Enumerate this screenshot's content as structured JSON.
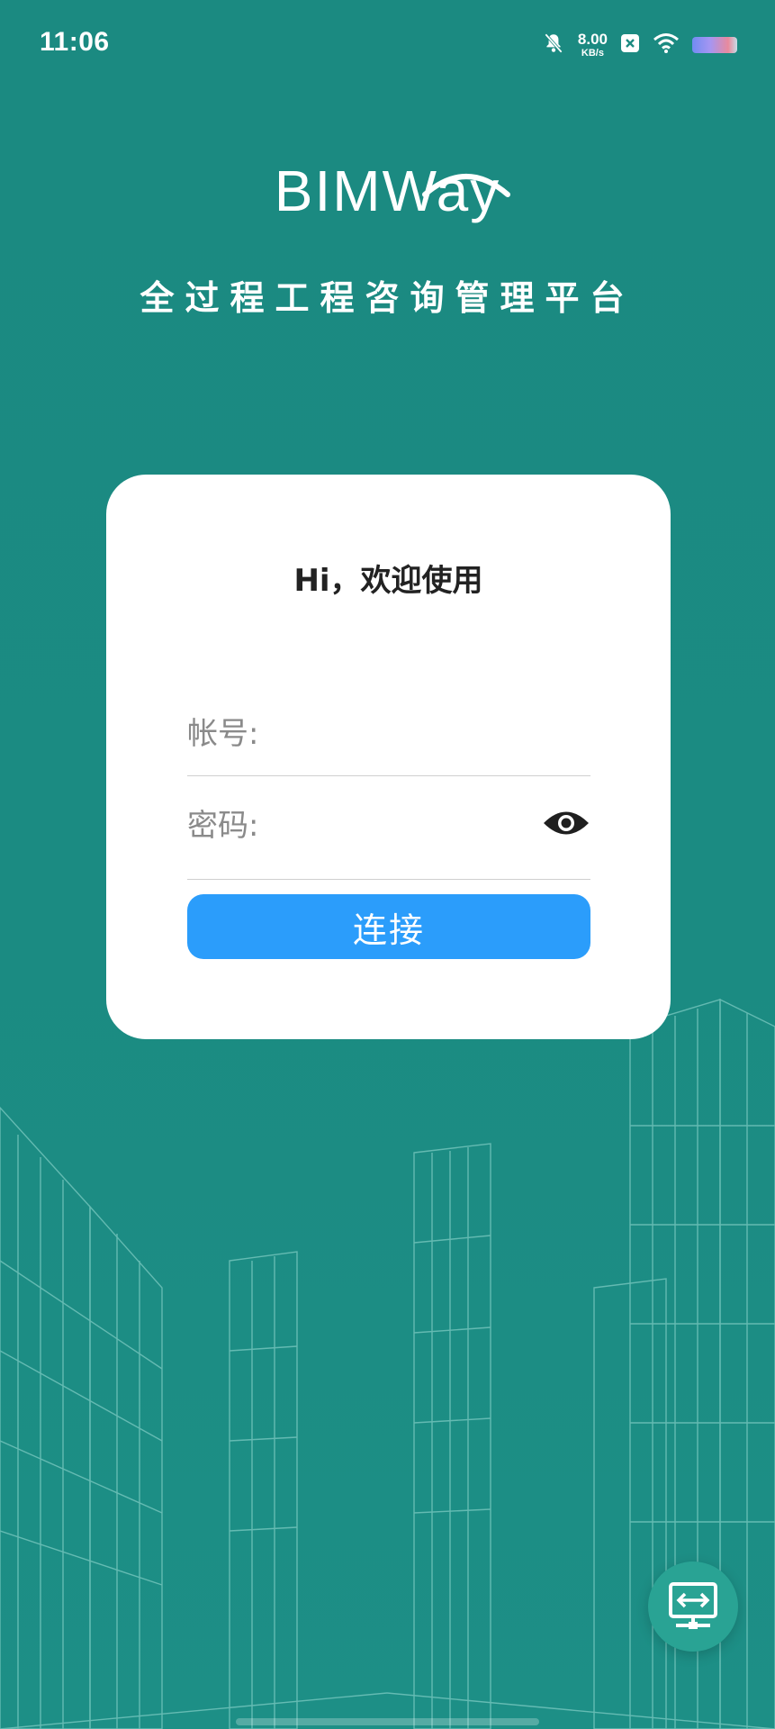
{
  "status_bar": {
    "time": "11:06",
    "net_speed_value": "8.00",
    "net_speed_unit": "KB/s",
    "icons": [
      "mute-bell-icon",
      "close-box-icon",
      "wifi-icon",
      "battery-icon"
    ]
  },
  "brand": {
    "logo_text": "BIMWay",
    "subtitle": "全过程工程咨询管理平台"
  },
  "login": {
    "greeting": "Hi，欢迎使用",
    "account_label": "帐号:",
    "account_value": "",
    "password_label": "密码:",
    "password_value": "",
    "connect_label": "连接"
  },
  "colors": {
    "background": "#1b8a81",
    "card": "#ffffff",
    "button": "#2b9dfb",
    "fab": "#29a394"
  },
  "fab": {
    "icon": "network-switch-icon"
  }
}
